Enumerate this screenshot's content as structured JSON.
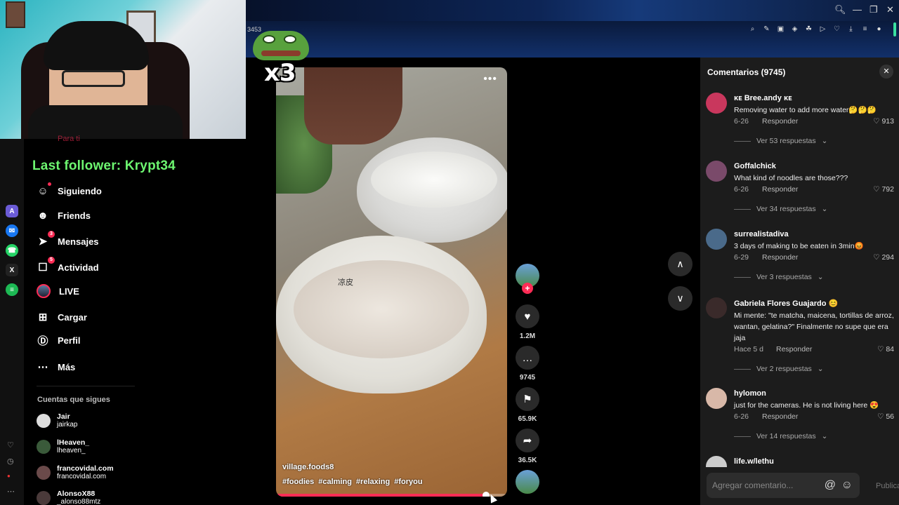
{
  "browser": {
    "tab_number": "3453",
    "ext_icons": [
      "zoom-icon",
      "edit-icon",
      "camera-icon",
      "shield-icon",
      "extension-icon",
      "play-icon",
      "heart-icon",
      "download-icon",
      "menu-icon",
      "account-icon"
    ]
  },
  "overlay": {
    "last_follower": "Last follower: Krypt34",
    "emote_count": "x3"
  },
  "sidebar": {
    "partial_item": "Para ti",
    "items": [
      {
        "label": "Siguiendo",
        "icon": "following-icon",
        "badge": ""
      },
      {
        "label": "Friends",
        "icon": "friends-icon",
        "badge": ""
      },
      {
        "label": "Mensajes",
        "icon": "messages-icon",
        "badge": "3"
      },
      {
        "label": "Actividad",
        "icon": "activity-icon",
        "badge": "5"
      },
      {
        "label": "LIVE",
        "icon": "live-icon",
        "badge": ""
      },
      {
        "label": "Cargar",
        "icon": "upload-icon",
        "badge": ""
      },
      {
        "label": "Perfil",
        "icon": "profile-icon",
        "badge": ""
      },
      {
        "label": "Más",
        "icon": "more-icon",
        "badge": ""
      }
    ],
    "following_title": "Cuentas que sigues",
    "following": [
      {
        "name": "Jair",
        "handle": "jairkap"
      },
      {
        "name": "lHeaven_",
        "handle": "lheaven_"
      },
      {
        "name": "francovidal.com",
        "handle": "francovidal.com"
      },
      {
        "name": "AlonsoX88",
        "handle": "_alonso88mtz"
      }
    ]
  },
  "video": {
    "caption_cn": "凉皮",
    "author": "village.foods8",
    "tags": [
      "#foodies",
      "#calming",
      "#relaxing",
      "#foryou"
    ],
    "progress_fraction": 0.91
  },
  "actions": {
    "likes": "1.2M",
    "comments": "9745",
    "saves": "65.9K",
    "shares": "36.5K"
  },
  "comments_panel": {
    "title": "Comentarios (9745)",
    "reply_label": "Responder",
    "comments": [
      {
        "user": "ᴋᴇ Bree.andy ᴋᴇ",
        "text": "Removing water to add more water🤔🤔🤔",
        "date": "6-26",
        "likes": "913",
        "replies": "Ver 53 respuestas",
        "color": "#c9375d"
      },
      {
        "user": "Goffalchick",
        "text": "What kind of noodles are those???",
        "date": "6-26",
        "likes": "792",
        "replies": "Ver 34 respuestas",
        "color": "#7a4a6a"
      },
      {
        "user": "surrealistadiva",
        "text": "3 days of making to be eaten in 3min😡",
        "date": "6-29",
        "likes": "294",
        "replies": "Ver 3 respuestas",
        "color": "#4a6a8a"
      },
      {
        "user": "Gabriela Flores Guajardo 😊",
        "text": "Mi mente: \"te matcha, maicena, tortillas de arroz, wantan, gelatina?\" Finalmente no supe que era jaja",
        "date": "Hace 5 d",
        "likes": "84",
        "replies": "Ver 2 respuestas",
        "color": "#3a2a2a"
      },
      {
        "user": "hylomon",
        "text": "just for the cameras. He is not living here 😍",
        "date": "6-26",
        "likes": "56",
        "replies": "Ver 14 respuestas",
        "color": "#d8b8a8"
      },
      {
        "user": "life.w/lethu",
        "text": "",
        "date": "",
        "likes": "",
        "replies": "",
        "color": "#ccc"
      }
    ],
    "input_placeholder": "Agregar comentario...",
    "post_label": "Publicar"
  }
}
